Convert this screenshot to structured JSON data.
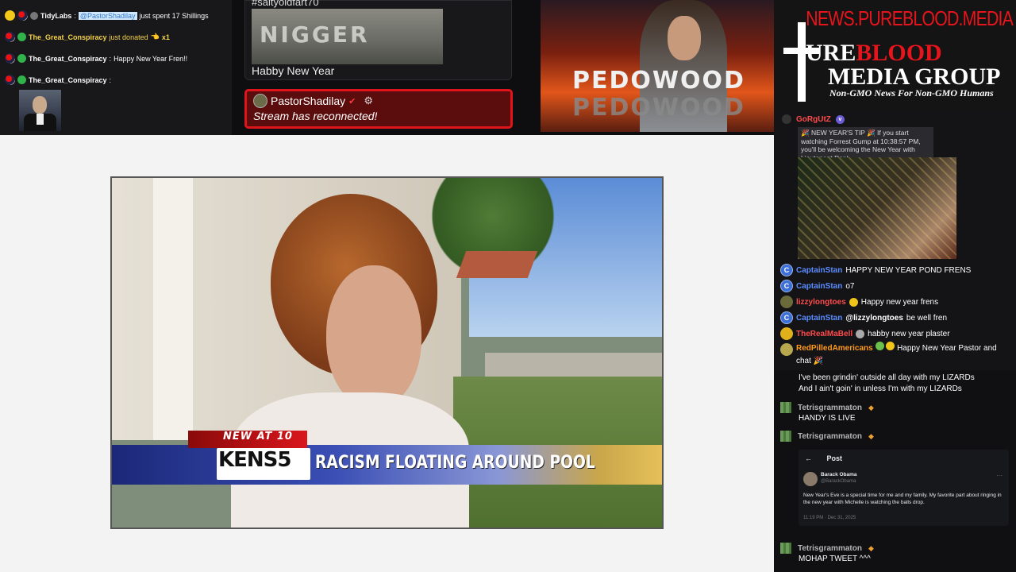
{
  "donations": {
    "row1": {
      "user": "TidyLabs",
      "sep": ":",
      "mention": "@PastorShadilay",
      "text": "just spent 17 Shillings"
    },
    "row2": {
      "user": "The_Great_Conspiracy",
      "text": "just donated",
      "amount": "x1"
    },
    "row3": {
      "user": "The_Great_Conspiracy",
      "sep": ":",
      "text": "Happy New Year Fren!!"
    },
    "row4": {
      "user": "The_Great_Conspiracy",
      "sep": ":"
    }
  },
  "media_card": {
    "tag": "#saltyoldfart70",
    "image_text": "NIGGER",
    "caption": "Habby New Year"
  },
  "reconnect": {
    "user": "PastorShadilay",
    "message": "Stream has reconnected!"
  },
  "art": {
    "word1": "PEDOWOOD",
    "word2": "PEDOWOOD"
  },
  "logo": {
    "site": "NEWS.PUREBLOOD.MEDIA",
    "line1_a": "URE",
    "line1_b": "BLOOD",
    "line2": "MEDIA GROUP",
    "tagline": "Non-GMO News For Non-GMO Humans"
  },
  "video": {
    "kicker": "NEW AT 10",
    "station": "KENS5",
    "headline": "RACISM FLOATING AROUND POOL"
  },
  "chat": {
    "tip_user": "GoRgUtZ",
    "tip_text": "🎉 NEW YEAR'S TIP 🎉 If you start watching Forrest Gump at 10:38:57 PM, you'll be welcoming the New Year with Lieutenant Dan!",
    "lines": [
      {
        "user": "CaptainStan",
        "text": "HAPPY NEW YEAR POND FRENS"
      },
      {
        "user": "CaptainStan",
        "text": "o7"
      },
      {
        "user": "lizzylongtoes",
        "text": "Happy new year frens"
      },
      {
        "user": "CaptainStan",
        "mention": "@lizzylongtoes",
        "text": "be well fren"
      },
      {
        "user": "TheRealMaBell",
        "text": "habby new year plaster"
      },
      {
        "user": "RedPilledAmericans",
        "text": "Happy New Year Pastor and chat 🎉"
      }
    ],
    "bottom": {
      "text1": "I've been grindin' outside all day with my LIZARDs",
      "text2": "And I ain't goin' in unless I'm with my LIZARDs",
      "user1": "Tetrisgrammaton",
      "msg1": "HANDY IS LIVE",
      "user2": "Tetrisgrammaton",
      "user3": "Tetrisgrammaton",
      "msg3": "MOHAP TWEET ^^^"
    },
    "tweet": {
      "back": "←",
      "title": "Post",
      "name": "Barack Obama",
      "handle": "@BarackObama",
      "more": "···",
      "body": "New Year's Eve is a special time for me and my family. My favorite part about ringing in the new year with Michelle is watching the balls drop.",
      "time": "11:19 PM · Dec 31, 2025"
    }
  },
  "colors": {
    "reconnect_border": "#e0141b",
    "brand_red": "#e8141b",
    "chat_bg": "#0f0f11"
  }
}
